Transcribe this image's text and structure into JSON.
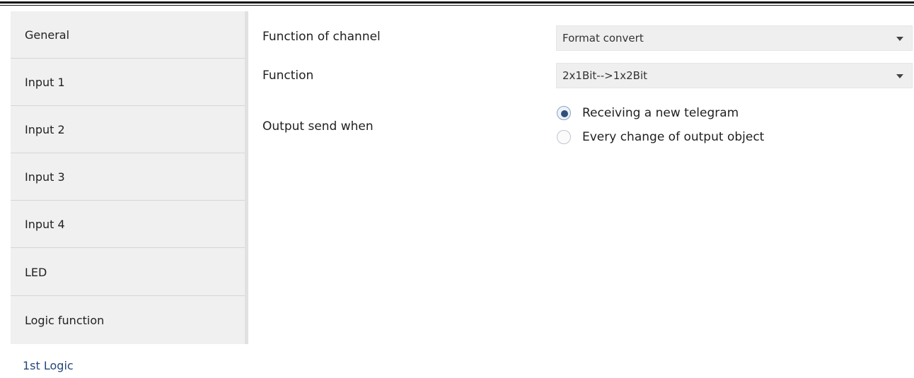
{
  "sidebar": {
    "items": [
      {
        "label": "General"
      },
      {
        "label": "Input 1"
      },
      {
        "label": "Input 2"
      },
      {
        "label": "Input 3"
      },
      {
        "label": "Input 4"
      },
      {
        "label": "LED"
      },
      {
        "label": "Logic function"
      }
    ],
    "sub_item": {
      "label": "1st Logic"
    }
  },
  "form": {
    "function_of_channel": {
      "label": "Function of channel",
      "value": "Format convert"
    },
    "function": {
      "label": "Function",
      "value": "2x1Bit-->1x2Bit"
    },
    "output_send_when": {
      "label": "Output send when",
      "options": [
        {
          "label": "Receiving a new telegram",
          "selected": true
        },
        {
          "label": "Every change of output object",
          "selected": false
        }
      ]
    }
  },
  "colors": {
    "sidebar_bg": "#f0f0f0",
    "sub_item_text": "#24477a",
    "radio_selected": "#2f4f7f"
  }
}
